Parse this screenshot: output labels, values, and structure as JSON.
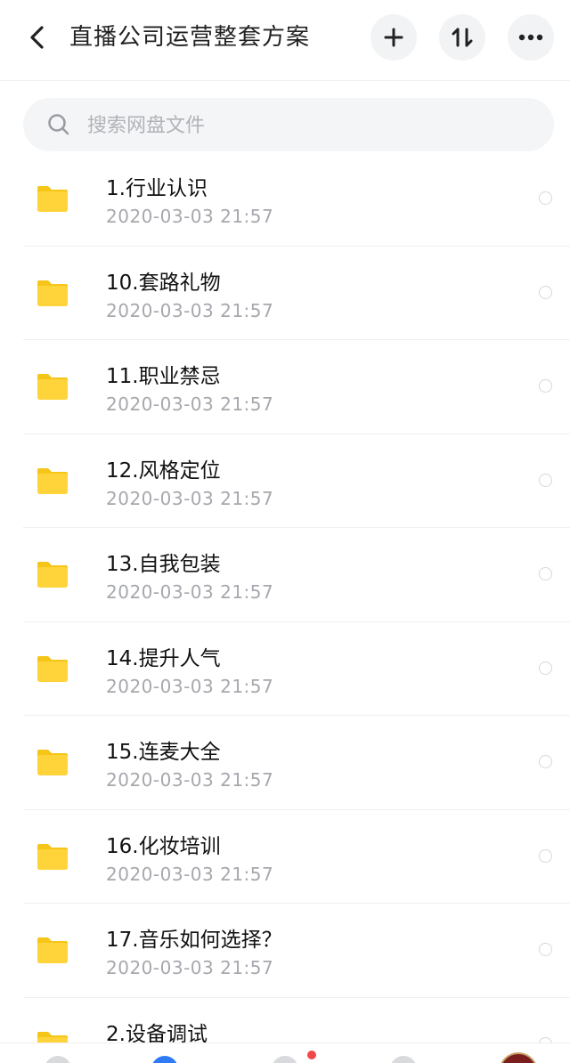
{
  "header": {
    "title": "直播公司运营整套方案",
    "back_icon": "chevron-left-icon",
    "add_icon": "plus-icon",
    "sort_icon": "sort-icon",
    "more_icon": "more-icon"
  },
  "search": {
    "placeholder": "搜索网盘文件",
    "value": ""
  },
  "files": [
    {
      "name": "1.行业认识",
      "date": "2020-03-03  21:57"
    },
    {
      "name": "10.套路礼物",
      "date": "2020-03-03  21:57"
    },
    {
      "name": "11.职业禁忌",
      "date": "2020-03-03  21:57"
    },
    {
      "name": "12.风格定位",
      "date": "2020-03-03  21:57"
    },
    {
      "name": "13.自我包装",
      "date": "2020-03-03  21:57"
    },
    {
      "name": "14.提升人气",
      "date": "2020-03-03  21:57"
    },
    {
      "name": "15.连麦大全",
      "date": "2020-03-03  21:57"
    },
    {
      "name": "16.化妆培训",
      "date": "2020-03-03  21:57"
    },
    {
      "name": "17.音乐如何选择？",
      "date": "2020-03-03  21:57"
    },
    {
      "name": "2.设备调试",
      "date": ""
    }
  ],
  "colors": {
    "folder": "#FFD43B",
    "folder_tab": "#F5C518",
    "notification_dot": "#F04848",
    "tab_active": "#2F7BF5"
  }
}
